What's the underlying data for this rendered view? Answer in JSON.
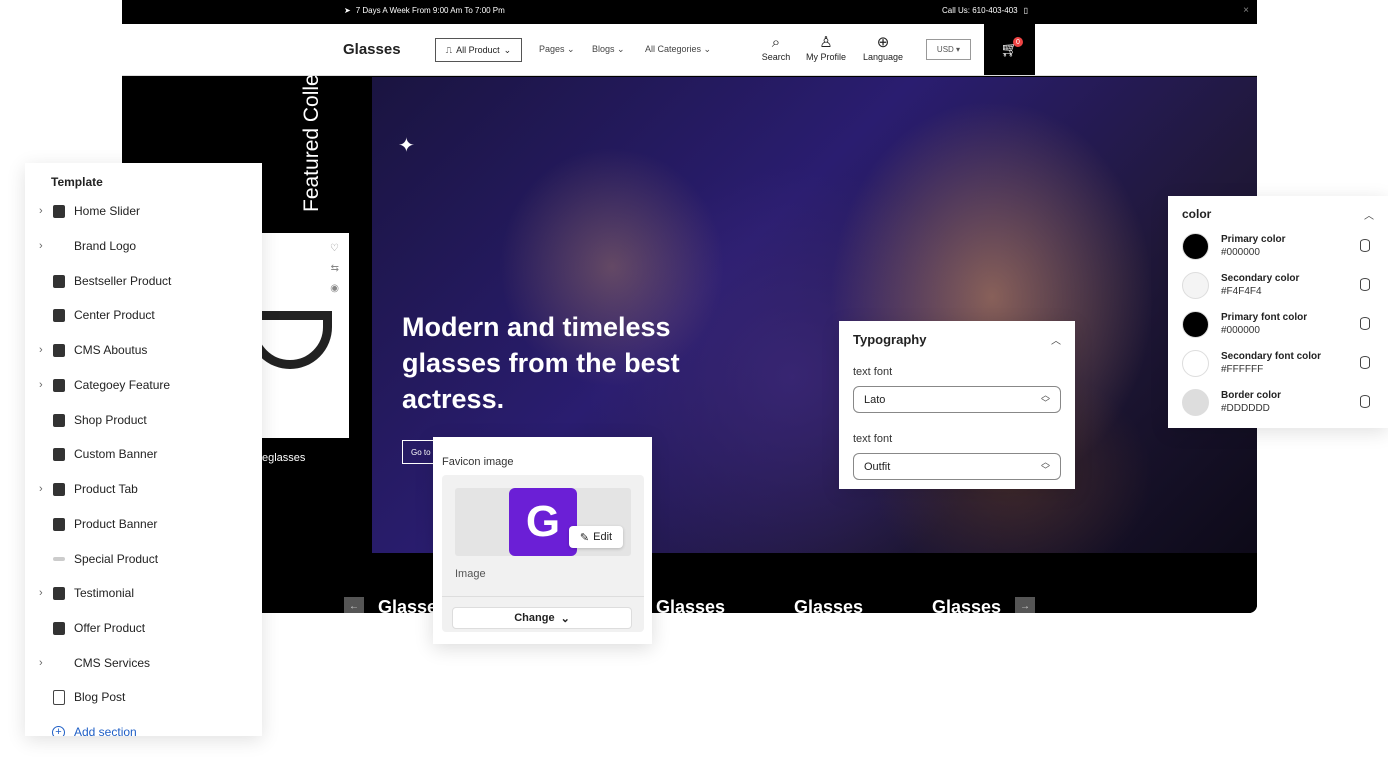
{
  "topbar": {
    "hours": "7 Days A Week From 9:00 Am To 7:00 Pm",
    "call": "Call Us: 610-403-403",
    "close": "×"
  },
  "nav": {
    "logo": "Glasses",
    "all_product": "All Product",
    "links": [
      "Pages",
      "Blogs",
      "All Categories"
    ],
    "search": "Search",
    "profile": "My Profile",
    "language": "Language",
    "currency": "USD",
    "cart_count": "0"
  },
  "hero": {
    "featured_title": "Featured Collection",
    "headline": "Modern and timeless glasses from the best actress.",
    "cta": "Go to",
    "side_caption": "eglasses"
  },
  "brands": [
    "Glasses",
    "Glasses",
    "Glasses",
    "Glasses"
  ],
  "template": {
    "heading": "Template",
    "items": [
      {
        "label": "Home Slider",
        "expandable": true,
        "thumb": "dark"
      },
      {
        "label": "Brand Logo",
        "expandable": true,
        "thumb": "none"
      },
      {
        "label": "Bestseller Product",
        "expandable": false,
        "thumb": "dark"
      },
      {
        "label": "Center Product",
        "expandable": false,
        "thumb": "dark"
      },
      {
        "label": "CMS Aboutus",
        "expandable": true,
        "thumb": "dark"
      },
      {
        "label": "Categoey Feature",
        "expandable": true,
        "thumb": "dark"
      },
      {
        "label": "Shop Product",
        "expandable": false,
        "thumb": "dark"
      },
      {
        "label": "Custom Banner",
        "expandable": false,
        "thumb": "dark"
      },
      {
        "label": "Product Tab",
        "expandable": true,
        "thumb": "dark"
      },
      {
        "label": "Product Banner",
        "expandable": false,
        "thumb": "dark"
      },
      {
        "label": "Special Product",
        "expandable": false,
        "thumb": "light"
      },
      {
        "label": "Testimonial",
        "expandable": true,
        "thumb": "dark"
      },
      {
        "label": "Offer Product",
        "expandable": false,
        "thumb": "dark"
      },
      {
        "label": "CMS Services",
        "expandable": true,
        "thumb": "none"
      },
      {
        "label": "Blog Post",
        "expandable": false,
        "thumb": "doc"
      }
    ],
    "add_section": "Add section"
  },
  "favicon": {
    "title": "Favicon image",
    "letter": "G",
    "edit": "Edit",
    "image_label": "Image",
    "change": "Change",
    "tile_color": "#6b1fd6"
  },
  "typography": {
    "title": "Typography",
    "fields": [
      {
        "label": "text font",
        "value": "Lato"
      },
      {
        "label": "text font",
        "value": "Outfit"
      }
    ]
  },
  "colors": {
    "title": "color",
    "items": [
      {
        "name": "Primary color",
        "hex": "#000000"
      },
      {
        "name": "Secondary color",
        "hex": "#F4F4F4"
      },
      {
        "name": "Primary font color",
        "hex": "#000000"
      },
      {
        "name": "Secondary font color",
        "hex": "#FFFFFF"
      },
      {
        "name": "Border color",
        "hex": "#DDDDDD"
      }
    ]
  }
}
